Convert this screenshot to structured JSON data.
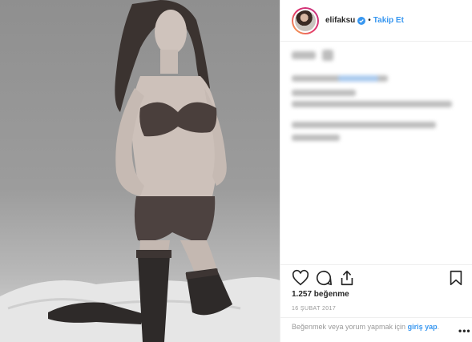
{
  "header": {
    "username": "elifaksu",
    "separator": "•",
    "follow_label": "Takip Et",
    "verified_color": "#3897f0"
  },
  "post": {
    "likes_text": "1.257 beğenme",
    "date_text": "16 ŞUBAT 2017",
    "comment_prompt": "Beğenmek veya yorum yapmak için",
    "login_link": "giriş yap",
    "login_suffix": ".",
    "more_label": "•••"
  },
  "icons": {
    "like": "heart-icon",
    "comment": "comment-icon",
    "share": "share-icon",
    "save": "bookmark-icon"
  },
  "colors": {
    "link_blue": "#3897f0",
    "text_primary": "#262626",
    "text_muted": "#999999",
    "divider": "#efefef"
  }
}
